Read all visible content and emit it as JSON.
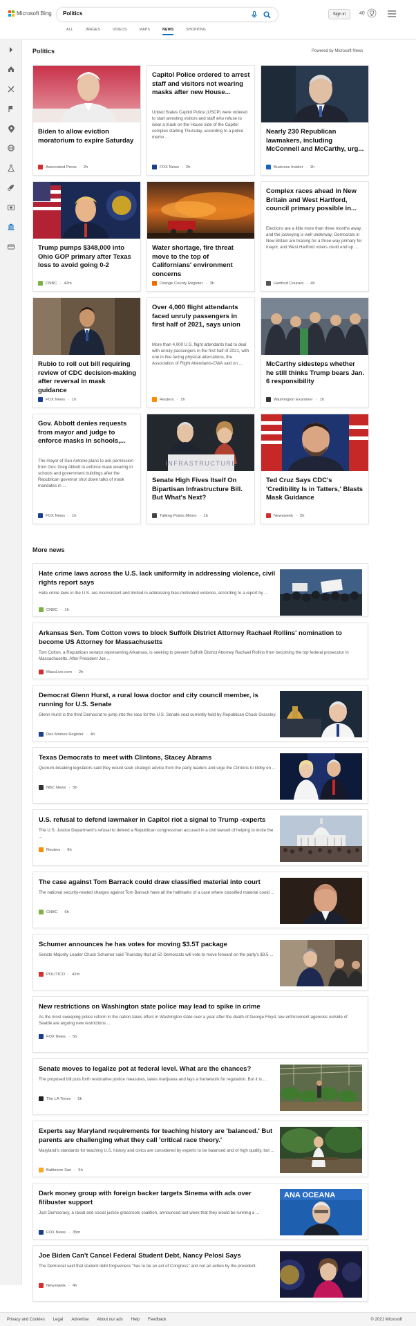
{
  "header": {
    "brand": "Microsoft Bing",
    "brand_colors": [
      "#f25022",
      "#7fba00",
      "#00a4ef",
      "#ffb900"
    ],
    "search_value": "Politics",
    "signin_label": "Sign in",
    "points": "40",
    "tabs": [
      {
        "label": "ALL"
      },
      {
        "label": "IMAGES"
      },
      {
        "label": "VIDEOS"
      },
      {
        "label": "MAPS"
      },
      {
        "label": "NEWS"
      },
      {
        "label": "SHOPPING"
      }
    ],
    "active_tab": "NEWS",
    "accent": "#0c6dc3"
  },
  "rail": {
    "icons": [
      "expand-icon",
      "home-icon",
      "sports-icon",
      "flag-icon",
      "location-icon",
      "globe-icon",
      "science-icon",
      "rocket-icon",
      "entertainment-icon",
      "money-icon",
      "car-icon"
    ]
  },
  "section": {
    "title": "Politics",
    "powered": "Powered by Microsoft News"
  },
  "cards": [
    {
      "title": "Biden to allow eviction moratorium to expire Saturday",
      "desc": "",
      "source": "Associated Press",
      "age": "2h",
      "fav": "#d32f2f"
    },
    {
      "title": "Capitol Police ordered to arrest staff and visitors not wearing masks after new House...",
      "desc": "United States Capitol Police (USCP) were ordered to start arresting visitors and staff who refuse to wear a mask on the House side of the Capitol complex starting Thursday, according to a police memo ...",
      "source": "FOX News",
      "age": "2h",
      "fav": "#1a3f8f"
    },
    {
      "title": "Nearly 230 Republican lawmakers, including McConnell and McCarthy, urg...",
      "desc": "",
      "source": "Business Insider",
      "age": "1h",
      "fav": "#1565c0"
    },
    {
      "title": "Trump pumps $348,000 into Ohio GOP primary after Texas loss to avoid going 0-2",
      "desc": "",
      "source": "CNBC",
      "age": "42m",
      "fav": "#7cb342"
    },
    {
      "title": "Water shortage, fire threat move to the top of Californians' environment concerns",
      "desc": "",
      "source": "Orange County Register",
      "age": "3h",
      "fav": "#ef6c00"
    },
    {
      "title": "Complex races ahead in New Britain and West Hartford, council primary possible in...",
      "desc": "Elections are a little more than three months away, and the jockeying is well underway: Democrats in New Britain are bracing for a three-way primary for mayor, and West Hartford voters could end up ...",
      "source": "Hartford Courant",
      "age": "4h",
      "fav": "#555555"
    },
    {
      "title": "Rubio to roll out bill requiring review of CDC decision-making after reversal in mask guidance",
      "desc": "",
      "source": "FOX News",
      "age": "1h",
      "fav": "#1a3f8f"
    },
    {
      "title": "Over 4,000 flight attendants faced unruly passengers in first half of 2021, says union",
      "desc": "More than 4,000 U.S. flight attendants had to deal with unruly passengers in the first half of 2021, with one in five facing physical altercations, the Association of Flight Attendants-CWA said on ...",
      "source": "Reuters",
      "age": "1h",
      "fav": "#fb8c00"
    },
    {
      "title": "McCarthy sidesteps whether he still thinks Trump bears Jan. 6 responsibility",
      "desc": "",
      "source": "Washington Examiner",
      "age": "1h",
      "fav": "#333333"
    },
    {
      "title": "Gov. Abbott denies requests from mayor and judge to enforce masks in schools,...",
      "desc": "The mayor of San Antonio plans to ask permission from Gov. Greg Abbott to enforce mask wearing in schools and government buildings after the Republican governor shot down talks of mask mandates in ...",
      "source": "FOX News",
      "age": "1h",
      "fav": "#1a3f8f"
    },
    {
      "title": "Senate High Fives Itself On Bipartisan Infrastructure Bill. But What's Next?",
      "desc": "",
      "source": "Talking Points Memo",
      "age": "1h",
      "fav": "#444444",
      "image_caption": "INFRASTRUCTURE"
    },
    {
      "title": "Ted Cruz Says CDC's 'Credibility Is in Tatters,' Blasts Mask Guidance",
      "desc": "",
      "source": "Newsweek",
      "age": "2h",
      "fav": "#d32f2f"
    }
  ],
  "more_news": {
    "title": "More news",
    "items": [
      {
        "title": "Hate crime laws across the U.S. lack uniformity in addressing violence, civil rights report says",
        "desc": "Hate crime laws in the U.S. are inconsistent and limited in addressing bias-motivated violence, according to a report by ...",
        "source": "CNBC",
        "age": "1h",
        "fav": "#7cb342"
      },
      {
        "title": "Arkansas Sen. Tom Cotton vows to block Suffolk District Attorney Rachael Rollins' nomination to become US Attorney for Massachusetts",
        "desc": "Tom Cotton, a Republican senator representing Arkansas, is seeking to prevent Suffolk District Attorney Rachael Rollins from becoming the top federal prosecutor in Massachusetts. After President Joe ...",
        "source": "MassLive.com",
        "age": "2h",
        "fav": "#d32f2f"
      },
      {
        "title": "Democrat Glenn Hurst, a rural Iowa doctor and city council member, is running for U.S. Senate",
        "desc": "Glenn Hurst is the third Democrat to jump into the race for the U.S. Senate seat currently held by Republican Chuck Grassley.",
        "source": "Des Moines Register",
        "age": "4h",
        "fav": "#1a3f8f"
      },
      {
        "title": "Texas Democrats to meet with Clintons, Stacey Abrams",
        "desc": "Quorum-breaking legislators said they would seek strategic advice from the party leaders and urge the Clintons to lobby on ...",
        "source": "NBC News",
        "age": "5h",
        "fav": "#333333"
      },
      {
        "title": "U.S. refusal to defend lawmaker in Capitol riot a signal to Trump -experts",
        "desc": "The U.S. Justice Department's refusal to defend a Republican congressman accused in a civil lawsuit of helping to incite the ...",
        "source": "Reuters",
        "age": "6h",
        "fav": "#fb8c00"
      },
      {
        "title": "The case against Tom Barrack could draw classified material into court",
        "desc": "The national security-related charges against Tom Barrack have all the hallmarks of a case where classified material could ...",
        "source": "CNBC",
        "age": "6h",
        "fav": "#7cb342"
      },
      {
        "title": "Schumer announces he has votes for moving $3.5T package",
        "desc": "Senate Majority Leader Chuck Schumer said Thursday that all 50 Democrats will vote to move forward on the party's $3.5 ...",
        "source": "POLITICO",
        "age": "42m",
        "fav": "#d32f2f"
      },
      {
        "title": "New restrictions on Washington state police may lead to spike in crime",
        "desc": "As the most sweeping police reform in the nation takes effect in Washington state over a year after the death of George Floyd, law enforcement agencies outside of Seattle are arguing new restrictions ...",
        "source": "FOX News",
        "age": "5h",
        "fav": "#1a3f8f"
      },
      {
        "title": "Senate moves to legalize pot at federal level. What are the chances?",
        "desc": "The proposed bill puts forth restorative justice measures, taxes marijuana and lays a framework for regulation. But it is ...",
        "source": "The LA Times",
        "age": "5h",
        "fav": "#222222"
      },
      {
        "title": "Experts say Maryland requirements for teaching history are 'balanced.' But parents are challenging what they call 'critical race theory.'",
        "desc": "Maryland's standards for teaching U.S. history and civics are considered by experts to be balanced and of high quality, but ...",
        "source": "Baltimore Sun",
        "age": "5h",
        "fav": "#f9a825"
      },
      {
        "title": "Dark money group with foreign backer targets Sinema with ads over filibuster support",
        "desc": "Just Democracy, a racial and social justice grassroots coalition, announced last week that they would be running a ...",
        "source": "FOX News",
        "age": "35m",
        "fav": "#1a3f8f",
        "image_caption": "ANA OCEANA"
      },
      {
        "title": "Joe Biden Can't Cancel Federal Student Debt, Nancy Pelosi Says",
        "desc": "The Democrat said that student debt forgiveness \"has to be an act of Congress\" and not an action by the president.",
        "source": "Newsweek",
        "age": "4h",
        "fav": "#d32f2f"
      }
    ]
  },
  "footer": {
    "links": [
      "Privacy and Cookies",
      "Legal",
      "Advertise",
      "About our ads",
      "Help",
      "Feedback"
    ],
    "copyright": "© 2021 Microsoft"
  }
}
